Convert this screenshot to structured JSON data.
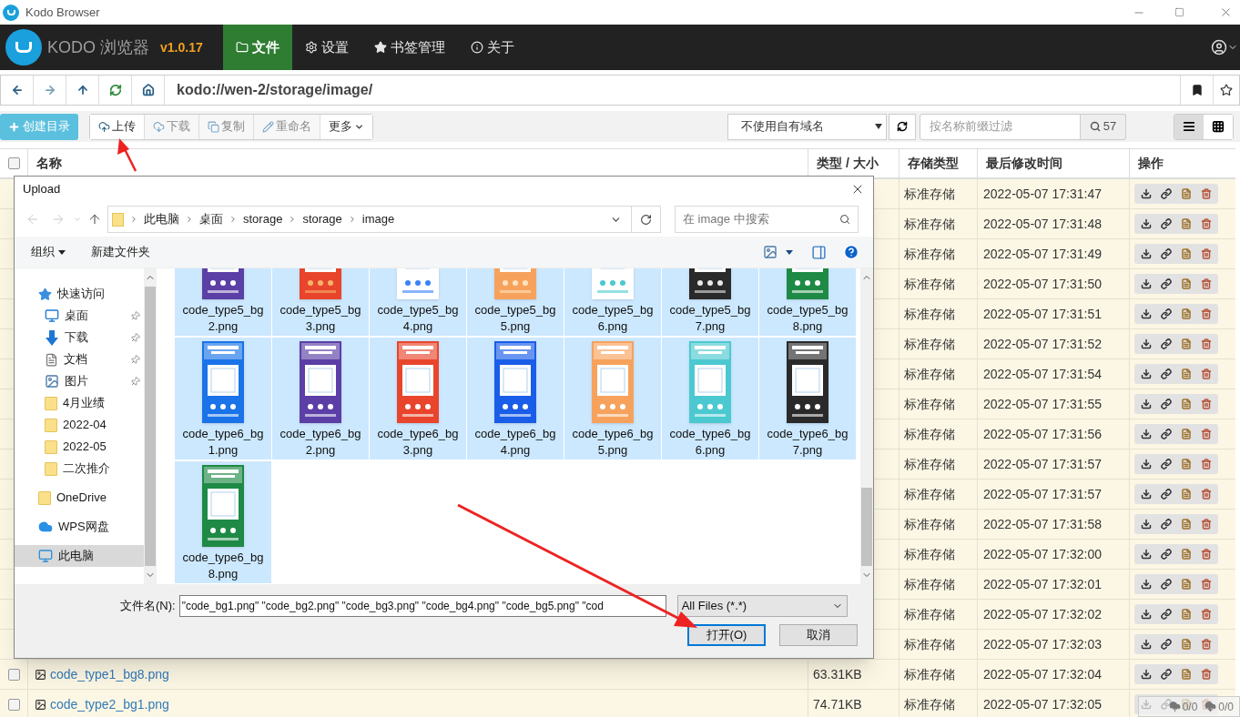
{
  "window": {
    "title": "Kodo Browser"
  },
  "app": {
    "name": "KODO 浏览器",
    "version": "v1.0.17"
  },
  "nav_tabs": [
    {
      "label": "文件",
      "selected": true
    },
    {
      "label": "设置",
      "selected": false
    },
    {
      "label": "书签管理",
      "selected": false
    },
    {
      "label": "关于",
      "selected": false
    }
  ],
  "address": {
    "path": "kodo://wen-2/storage/image/"
  },
  "toolbar": {
    "create": "创建目录",
    "actions": [
      {
        "label": "上传",
        "disabled": false
      },
      {
        "label": "下载",
        "disabled": true
      },
      {
        "label": "复制",
        "disabled": true
      },
      {
        "label": "重命名",
        "disabled": true
      },
      {
        "label": "更多",
        "disabled": false
      }
    ],
    "domain_select": "不使用自有域名",
    "filter": {
      "placeholder": "按名称前缀过滤"
    },
    "count": "57",
    "views": [
      {
        "selected": true
      },
      {
        "selected": false
      }
    ]
  },
  "table": {
    "all_checked": false,
    "columns": [
      "名称",
      "类型 / 大小",
      "存储类型",
      "最后修改时间",
      "操作"
    ],
    "rows": [
      {
        "storage": "标准存储",
        "modified": "2022-05-07 17:31:47"
      },
      {
        "storage": "标准存储",
        "modified": "2022-05-07 17:31:48"
      },
      {
        "storage": "标准存储",
        "modified": "2022-05-07 17:31:49"
      },
      {
        "storage": "标准存储",
        "modified": "2022-05-07 17:31:50"
      },
      {
        "storage": "标准存储",
        "modified": "2022-05-07 17:31:51"
      },
      {
        "storage": "标准存储",
        "modified": "2022-05-07 17:31:52"
      },
      {
        "storage": "标准存储",
        "modified": "2022-05-07 17:31:54"
      },
      {
        "storage": "标准存储",
        "modified": "2022-05-07 17:31:55"
      },
      {
        "storage": "标准存储",
        "modified": "2022-05-07 17:31:56"
      },
      {
        "storage": "标准存储",
        "modified": "2022-05-07 17:31:57"
      },
      {
        "storage": "标准存储",
        "modified": "2022-05-07 17:31:57"
      },
      {
        "storage": "标准存储",
        "modified": "2022-05-07 17:31:58"
      },
      {
        "storage": "标准存储",
        "modified": "2022-05-07 17:32:00"
      },
      {
        "storage": "标准存储",
        "modified": "2022-05-07 17:32:01"
      },
      {
        "storage": "标准存储",
        "modified": "2022-05-07 17:32:02"
      },
      {
        "storage": "标准存储",
        "modified": "2022-05-07 17:32:03"
      },
      {
        "checked": false,
        "name": "code_type1_bg8.png",
        "size": "63.31KB",
        "storage": "标准存储",
        "modified": "2022-05-07 17:32:04"
      },
      {
        "checked": false,
        "name": "code_type2_bg1.png",
        "size": "74.71KB",
        "storage": "标准存储",
        "modified": "2022-05-07 17:32:05"
      }
    ]
  },
  "upload_dialog": {
    "title": "Upload",
    "breadcrumb": [
      "此电脑",
      "桌面",
      "storage",
      "storage",
      "image"
    ],
    "search": {
      "placeholder": "在 image 中搜索"
    },
    "organize": "组织",
    "new_folder": "新建文件夹",
    "nav": [
      {
        "label": "快速访问",
        "kind": "quick_access",
        "selected": false,
        "children": [
          {
            "label": "桌面",
            "kind": "desktop",
            "pinned": true,
            "selected": false
          },
          {
            "label": "下载",
            "kind": "downloads",
            "pinned": true,
            "selected": false
          },
          {
            "label": "文档",
            "kind": "documents",
            "pinned": true,
            "selected": false
          },
          {
            "label": "图片",
            "kind": "pictures",
            "pinned": true,
            "selected": false
          },
          {
            "label": "4月业绩",
            "kind": "folder",
            "pinned": false,
            "selected": false
          },
          {
            "label": "2022-04",
            "kind": "folder",
            "pinned": false,
            "selected": false
          },
          {
            "label": "2022-05",
            "kind": "folder",
            "pinned": false,
            "selected": false
          },
          {
            "label": "二次推介",
            "kind": "folder",
            "pinned": false,
            "selected": false
          }
        ]
      },
      {
        "label": "OneDrive",
        "kind": "folder",
        "selected": false
      },
      {
        "label": "WPS网盘",
        "kind": "cloud",
        "selected": false
      },
      {
        "label": "此电脑",
        "kind": "computer",
        "selected": true
      }
    ],
    "files": [
      {
        "name": "code_type5_bg2.png",
        "selected": true
      },
      {
        "name": "code_type5_bg3.png",
        "selected": true
      },
      {
        "name": "code_type5_bg4.png",
        "selected": true
      },
      {
        "name": "code_type5_bg5.png",
        "selected": true
      },
      {
        "name": "code_type5_bg6.png",
        "selected": true
      },
      {
        "name": "code_type5_bg7.png",
        "selected": true
      },
      {
        "name": "code_type5_bg8.png",
        "selected": true
      },
      {
        "name": "code_type6_bg1.png",
        "selected": true
      },
      {
        "name": "code_type6_bg2.png",
        "selected": true
      },
      {
        "name": "code_type6_bg3.png",
        "selected": true
      },
      {
        "name": "code_type6_bg4.png",
        "selected": true
      },
      {
        "name": "code_type6_bg5.png",
        "selected": true
      },
      {
        "name": "code_type6_bg6.png",
        "selected": true
      },
      {
        "name": "code_type6_bg7.png",
        "selected": true
      },
      {
        "name": "code_type6_bg8.png",
        "selected": true
      }
    ],
    "filename": {
      "label": "文件名(N):",
      "value": "\"code_bg1.png\" \"code_bg2.png\" \"code_bg3.png\" \"code_bg4.png\" \"code_bg5.png\" \"cod"
    },
    "filter": "All Files (*.*)",
    "buttons": [
      {
        "label": "打开(O)",
        "default": true
      },
      {
        "label": "取消",
        "default": false
      }
    ]
  },
  "transfers": {
    "upload": "0/0",
    "download": "0/0"
  }
}
